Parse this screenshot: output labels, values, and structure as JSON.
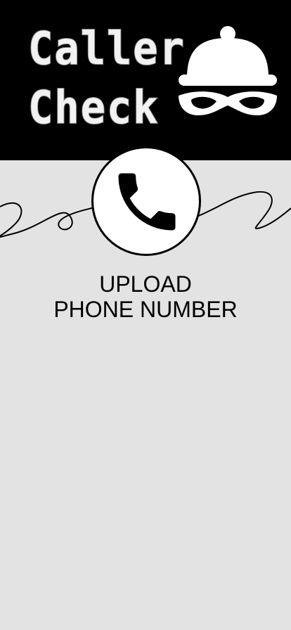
{
  "header": {
    "title_line1": "Caller",
    "title_line2": "Check",
    "logo_icon": "spy-masked-burglar-icon",
    "background": "#000000"
  },
  "upload": {
    "icon": "phone-handset-icon",
    "label_line1": "UPLOAD",
    "label_line2": "PHONE NUMBER"
  },
  "colors": {
    "page_background": "#e3e3e3",
    "accent": "#000000",
    "logo_text": "#f2f2f2"
  }
}
